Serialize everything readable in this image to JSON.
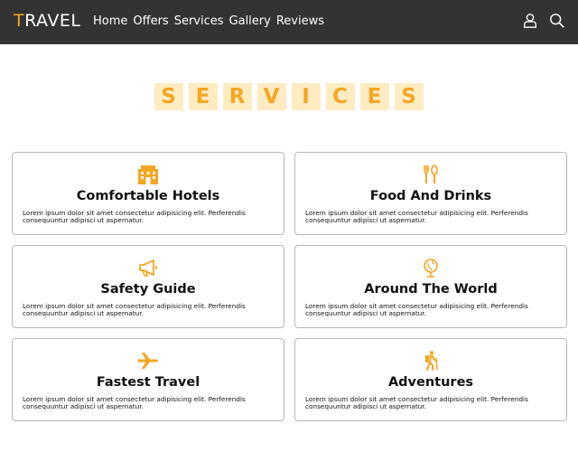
{
  "navbar": {
    "logo_first": "T",
    "logo_rest": "RAVEL",
    "links": [
      "Home",
      "Offers",
      "Services",
      "Gallery",
      "Reviews"
    ],
    "icons": [
      "user-icon",
      "search-icon"
    ]
  },
  "section": {
    "heading_letters": [
      "S",
      "E",
      "R",
      "V",
      "I",
      "C",
      "E",
      "S"
    ]
  },
  "services": [
    {
      "icon": "hotel-icon",
      "title": "Comfortable Hotels",
      "text": "Lorem ipsum dolor sit amet consectetur adipisicing elit. Perferendis consequuntur adipisci ut aspernatur."
    },
    {
      "icon": "food-icon",
      "title": "Food And Drinks",
      "text": "Lorem ipsum dolor sit amet consectetur adipisicing elit. Perferendis consequuntur adipisci ut aspernatur."
    },
    {
      "icon": "megaphone-icon",
      "title": "Safety Guide",
      "text": "Lorem ipsum dolor sit amet consectetur adipisicing elit. Perferendis consequuntur adipisci ut aspernatur."
    },
    {
      "icon": "globe-icon",
      "title": "Around The World",
      "text": "Lorem ipsum dolor sit amet consectetur adipisicing elit. Perferendis consequuntur adipisci ut aspernatur."
    },
    {
      "icon": "plane-icon",
      "title": "Fastest Travel",
      "text": "Lorem ipsum dolor sit amet consectetur adipisicing elit. Perferendis consequuntur adipisci ut aspernatur."
    },
    {
      "icon": "hiker-icon",
      "title": "Adventures",
      "text": "Lorem ipsum dolor sit amet consectetur adipisicing elit. Perferendis consequuntur adipisci ut aspernatur."
    }
  ],
  "colors": {
    "accent": "#f5a623",
    "accent_light": "#fdecc2",
    "navbar": "#333333"
  }
}
